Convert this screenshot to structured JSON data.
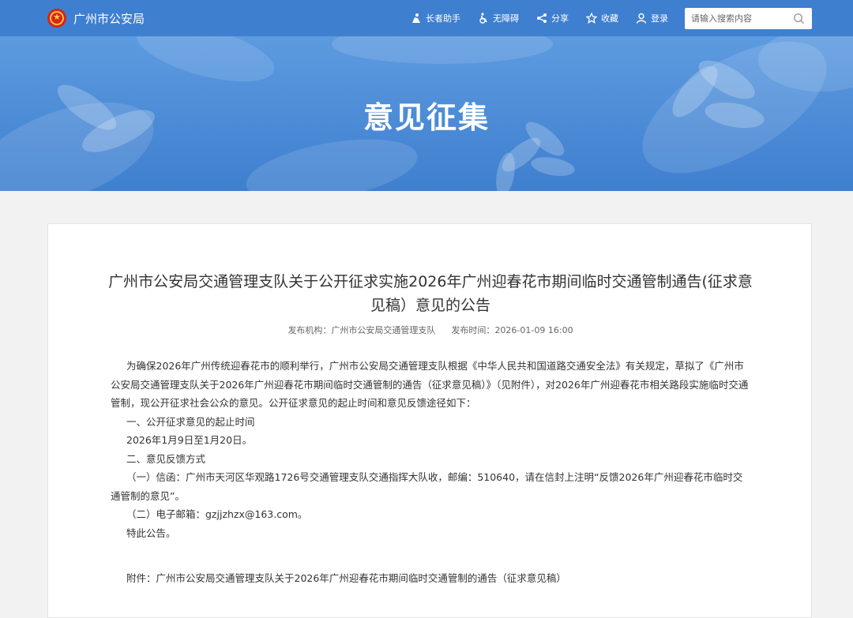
{
  "header": {
    "site_name": "广州市公安局",
    "nav": [
      {
        "label": "长者助手",
        "icon": "elder-icon"
      },
      {
        "label": "无障碍",
        "icon": "accessibility-icon"
      },
      {
        "label": "分享",
        "icon": "share-icon"
      },
      {
        "label": "收藏",
        "icon": "star-icon"
      },
      {
        "label": "登录",
        "icon": "user-icon"
      }
    ],
    "search_placeholder": "请输入搜索内容"
  },
  "banner": {
    "title": "意见征集"
  },
  "article": {
    "title": "广州市公安局交通管理支队关于公开征求实施2026年广州迎春花市期间临时交通管制通告(征求意见稿）意见的公告",
    "publisher_label": "发布机构：",
    "publisher": "广州市公安局交通管理支队",
    "date_label": "发布时间：",
    "date": "2026-01-09 16:00",
    "paragraphs": [
      "为确保2026年广州传统迎春花市的顺利举行，广州市公安局交通管理支队根据《中华人民共和国道路交通安全法》有关规定，草拟了《广州市公安局交通管理支队关于2026年广州迎春花市期间临时交通管制的通告（征求意见稿）》（见附件），对2026年广州迎春花市相关路段实施临时交通管制，现公开征求社会公众的意见。公开征求意见的起止时间和意见反馈途径如下：",
      "一、公开征求意见的起止时间",
      "2026年1月9日至1月20日。",
      "二、意见反馈方式",
      "（一）信函：广州市天河区华观路1726号交通管理支队交通指挥大队收，邮编：510640，请在信封上注明“反馈2026年广州迎春花市临时交通管制的意见”。",
      "（二）电子邮箱：gzjjzhzx@163.com。",
      "特此公告。"
    ],
    "attachment": "附件：广州市公安局交通管理支队关于2026年广州迎春花市期间临时交通管制的通告（征求意见稿）"
  }
}
